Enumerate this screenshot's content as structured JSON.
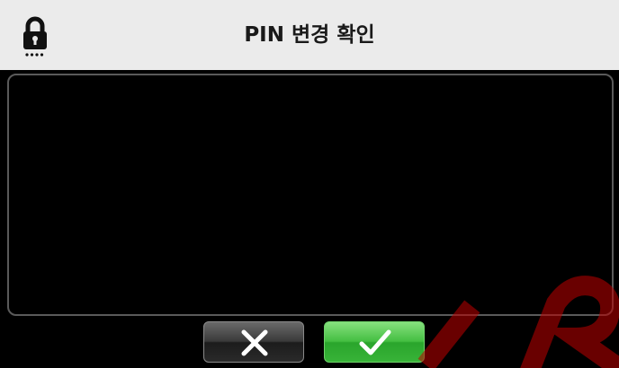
{
  "header": {
    "title": "PIN 변경 확인",
    "icon": "lock-icon"
  },
  "actions": {
    "cancel_icon": "close-icon",
    "confirm_icon": "checkmark-icon"
  },
  "colors": {
    "titlebar_bg": "#ebebeb",
    "screen_bg": "#000000",
    "confirm_green": "#3cb93a",
    "cancel_gray": "#3a3a3a"
  }
}
